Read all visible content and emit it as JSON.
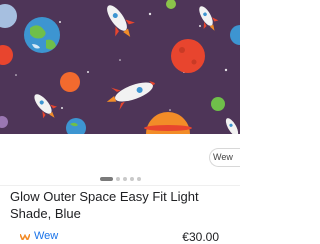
{
  "product": {
    "image_alt": "space themed light shade",
    "source_label": "Wew",
    "title": "Glow Outer Space Easy Fit Light Shade, Blue",
    "seller": "Wew",
    "price": "€30.00"
  },
  "carousel": {
    "count": 5,
    "active_index": 0
  },
  "colors": {
    "background": "#4e3558",
    "accent_blue": "#1a73e8",
    "planet_red": "#e8452e",
    "planet_orange": "#f28c28",
    "rocket_white": "#f2f2f2"
  },
  "icons": [
    "rocket-icon",
    "planet-icon",
    "star-icon",
    "seller-logo-icon"
  ]
}
